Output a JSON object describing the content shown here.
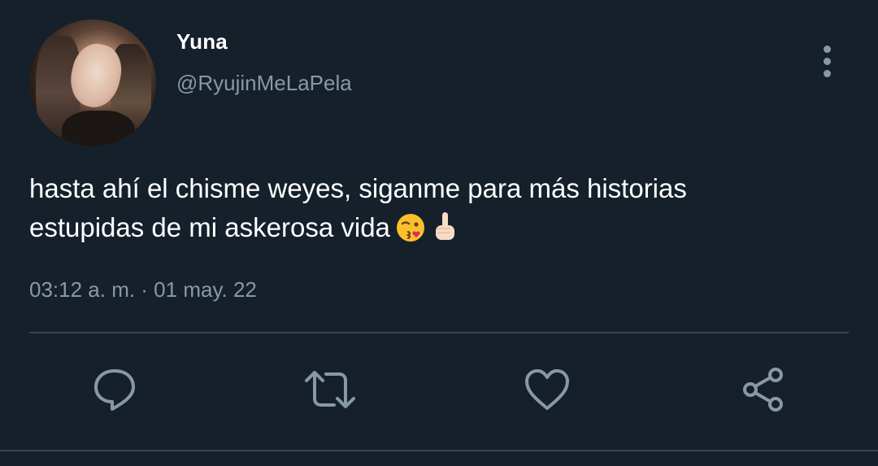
{
  "author": {
    "name": "Yuna",
    "handle": "@RyujinMeLaPela"
  },
  "tweet": {
    "text_line1": "hasta ahí el chisme weyes, siganme para más historias",
    "text_line2": "estupidas de mi askerosa vida",
    "emojis": [
      "kissing-face-emoji",
      "middle-finger-emoji"
    ],
    "timestamp": "03:12 a. m. · 01 may. 22"
  },
  "actions": [
    {
      "icon": "reply-icon"
    },
    {
      "icon": "retweet-icon"
    },
    {
      "icon": "like-icon"
    },
    {
      "icon": "share-icon"
    }
  ],
  "colors": {
    "background": "#15202b",
    "text_primary": "#ffffff",
    "text_secondary": "#8899a6",
    "divider": "#38444d"
  }
}
